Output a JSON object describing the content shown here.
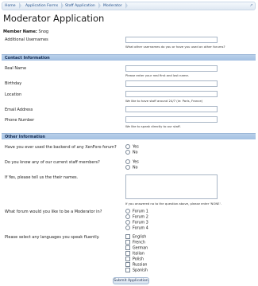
{
  "breadcrumb": {
    "items": [
      "Home",
      "Application Forms",
      "Staff Application",
      "Moderator"
    ],
    "arrow_icon": "jump-to-icon"
  },
  "page_title": "Moderator Application",
  "member": {
    "label": "Member Name:",
    "value": "Snog"
  },
  "fields": {
    "additional_usernames": {
      "label": "Additional Usernames",
      "hint": "What other usernames do you or have you used on other forums?"
    }
  },
  "sections": {
    "contact": "Contact Information",
    "other": "Other Information"
  },
  "contact": {
    "real_name": {
      "label": "Real Name",
      "hint": "Please enter your real first and last name."
    },
    "birthday": {
      "label": "Birthday"
    },
    "location": {
      "label": "Location",
      "hint": "We like to have staff around 24/7 (ie: Paris, France)"
    },
    "email": {
      "label": "Email Address"
    },
    "phone": {
      "label": "Phone Number",
      "hint": "We like to speak directly to our staff."
    }
  },
  "other": {
    "backend_question": "Have you ever used the backend of any XenForo forum?",
    "backend_options": [
      "Yes",
      "No"
    ],
    "staff_question": "Do you know any of our current staff members?",
    "staff_options": [
      "Yes",
      "No"
    ],
    "staff_names_label": "If Yes, please tell us the their names.",
    "staff_names_hint": "If you answered no to the question above, please enter 'NONE'.",
    "forum_question": "What forum would you like to be a Moderator in?",
    "forum_options": [
      "Forum 1",
      "Forum 2",
      "Forum 3",
      "Forum 4"
    ],
    "languages_question": "Please select any languages you speak fluently.",
    "languages": [
      "English",
      "French",
      "German",
      "Italian",
      "Polish",
      "Russian",
      "Spanish"
    ]
  },
  "submit_label": "Submit Application"
}
